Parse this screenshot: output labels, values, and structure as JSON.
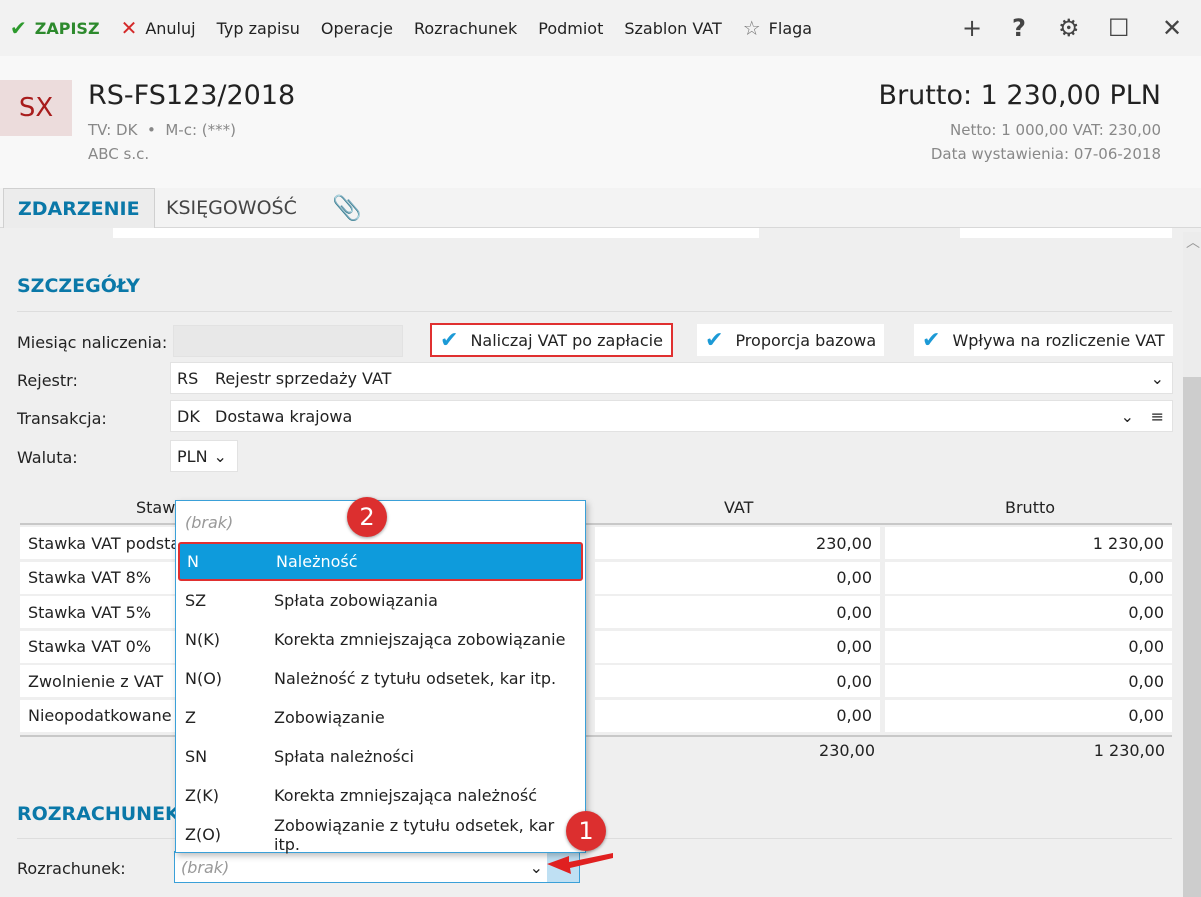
{
  "toolbar": {
    "save": "ZAPISZ",
    "cancel": "Anuluj",
    "items": [
      "Typ zapisu",
      "Operacje",
      "Rozrachunek",
      "Podmiot",
      "Szablon VAT"
    ],
    "flag": "Flaga",
    "help": "?"
  },
  "header": {
    "badge": "SX",
    "title": "RS-FS123/2018",
    "meta1": "TV: DK",
    "meta2": "M-c: (***)",
    "company": "ABC s.c.",
    "brutto": "Brutto: 1 230,00 PLN",
    "netto_vat": "Netto: 1 000,00 VAT: 230,00",
    "date": "Data wystawienia: 07-06-2018"
  },
  "tabs": [
    {
      "label": "ZDARZENIE",
      "active": true
    },
    {
      "label": "KSIĘGOWOŚĆ"
    }
  ],
  "details": {
    "title": "SZCZEGÓŁY",
    "month_label": "Miesiąc naliczenia:",
    "month_value": "",
    "checks": [
      {
        "label": "Naliczaj VAT po zapłacie",
        "checked": true
      },
      {
        "label": "Proporcja bazowa",
        "checked": true
      },
      {
        "label": "Wpływa na rozliczenie VAT",
        "checked": true
      }
    ],
    "register_label": "Rejestr:",
    "register_code": "RS",
    "register_name": "Rejestr sprzedaży VAT",
    "transaction_label": "Transakcja:",
    "transaction_code": "DK",
    "transaction_name": "Dostawa krajowa",
    "currency_label": "Waluta:",
    "currency": "PLN"
  },
  "table": {
    "headers": {
      "rate": "Stawka",
      "vat": "VAT",
      "brutto": "Brutto"
    },
    "rows": [
      {
        "rate": "Stawka VAT podstawowa",
        "vat": "230,00",
        "brutto": "1 230,00"
      },
      {
        "rate": "Stawka VAT 8%",
        "vat": "0,00",
        "brutto": "0,00"
      },
      {
        "rate": "Stawka VAT 5%",
        "vat": "0,00",
        "brutto": "0,00"
      },
      {
        "rate": "Stawka VAT 0%",
        "vat": "0,00",
        "brutto": "0,00"
      },
      {
        "rate": "Zwolnienie z VAT",
        "vat": "0,00",
        "brutto": "0,00"
      },
      {
        "rate": "Nieopodatkowane",
        "vat": "0,00",
        "brutto": "0,00"
      }
    ],
    "totals": {
      "vat": "230,00",
      "brutto": "1 230,00"
    }
  },
  "settlement": {
    "title": "ROZRACHUNEK",
    "label": "Rozrachunek:",
    "value": "(brak)"
  },
  "dropdown": {
    "empty": "(brak)",
    "selected_index": 0,
    "items": [
      {
        "code": "N",
        "name": "Należność"
      },
      {
        "code": "SZ",
        "name": "Spłata zobowiązania"
      },
      {
        "code": "N(K)",
        "name": "Korekta zmniejszająca zobowiązanie"
      },
      {
        "code": "N(O)",
        "name": "Należność z tytułu odsetek, kar itp."
      },
      {
        "code": "Z",
        "name": "Zobowiązanie"
      },
      {
        "code": "SN",
        "name": "Spłata należności"
      },
      {
        "code": "Z(K)",
        "name": "Korekta zmniejszająca należność"
      },
      {
        "code": "Z(O)",
        "name": "Zobowiązanie z tytułu odsetek, kar itp."
      }
    ]
  },
  "annotations": {
    "one": "1",
    "two": "2"
  },
  "colors": {
    "accent": "#0a78a8",
    "selection": "#0e9bdc",
    "annotation": "#dc2f2f"
  }
}
